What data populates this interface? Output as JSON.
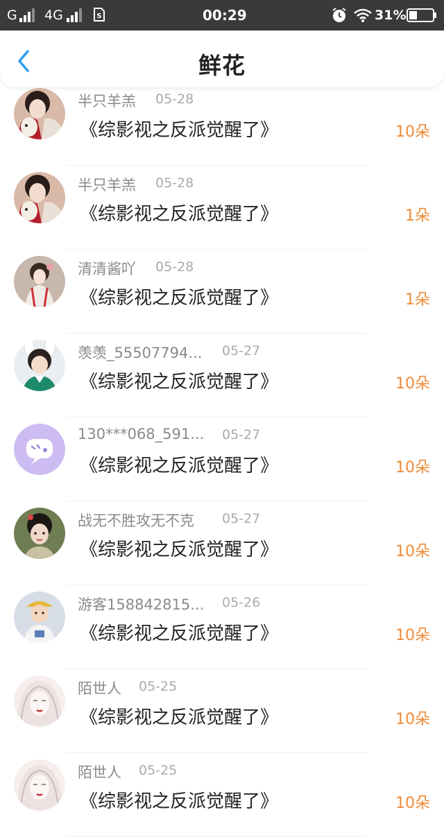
{
  "status_bar": {
    "carrier1": "G",
    "carrier2": "4G",
    "time": "00:29",
    "battery": "31%"
  },
  "header": {
    "title": "鲜花",
    "back_icon": "chevron-left-icon",
    "accent_color": "#2e9cf0"
  },
  "gifts": [
    {
      "user": "半只羊羔",
      "date": "05-28",
      "book": "《综影视之反派觉醒了》",
      "amount": "10朵",
      "avatar": "girl-with-plush-avatar"
    },
    {
      "user": "半只羊羔",
      "date": "05-28",
      "book": "《综影视之反派觉醒了》",
      "amount": "1朵",
      "avatar": "girl-with-plush-avatar"
    },
    {
      "user": "清清酱吖",
      "date": "05-28",
      "book": "《综影视之反派觉醒了》",
      "amount": "1朵",
      "avatar": "girl-in-hanfu-avatar"
    },
    {
      "user": "羡羡_55507794...",
      "date": "05-27",
      "book": "《综影视之反派觉醒了》",
      "amount": "10朵",
      "avatar": "boy-with-bunny-ears-avatar"
    },
    {
      "user": "130***068_591...",
      "date": "05-27",
      "book": "《综影视之反派觉醒了》",
      "amount": "10朵",
      "avatar": "default-chat-avatar"
    },
    {
      "user": "战无不胜攻无不克",
      "date": "05-27",
      "book": "《综影视之反派觉醒了》",
      "amount": "10朵",
      "avatar": "actress-portrait-avatar"
    },
    {
      "user": "游客158842815...",
      "date": "05-26",
      "book": "《综影视之反派觉醒了》",
      "amount": "10朵",
      "avatar": "child-with-hat-avatar"
    },
    {
      "user": "陌世人",
      "date": "05-25",
      "book": "《综影视之反派觉醒了》",
      "amount": "10朵",
      "avatar": "illustrated-girl-avatar"
    },
    {
      "user": "陌世人",
      "date": "05-25",
      "book": "《综影视之反派觉醒了》",
      "amount": "10朵",
      "avatar": "illustrated-girl-avatar"
    }
  ],
  "colors": {
    "amount": "#f08a35",
    "username": "#8a8a8a",
    "status_bar": "#3a3a3a"
  }
}
